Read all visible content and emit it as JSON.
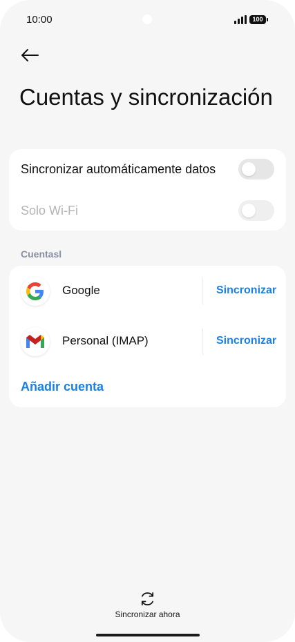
{
  "status_bar": {
    "time": "10:00",
    "battery": "100"
  },
  "header": {
    "title": "Cuentas y sincronización"
  },
  "sync_settings": {
    "auto_sync_label": "Sincronizar automáticamente datos",
    "auto_sync_on": false,
    "wifi_only_label": "Solo Wi-Fi",
    "wifi_only_on": false
  },
  "accounts_section": {
    "header": "Cuentasl",
    "items": [
      {
        "name": "Google",
        "icon": "google-icon",
        "action": "Sincronizar"
      },
      {
        "name": "Personal (IMAP)",
        "icon": "gmail-icon",
        "action": "Sincronizar"
      }
    ],
    "add_account_label": "Añadir cuenta"
  },
  "footer": {
    "sync_now_label": "Sincronizar ahora"
  },
  "colors": {
    "accent": "#1a80e5",
    "background": "#f6f6f6",
    "card": "#ffffff"
  }
}
